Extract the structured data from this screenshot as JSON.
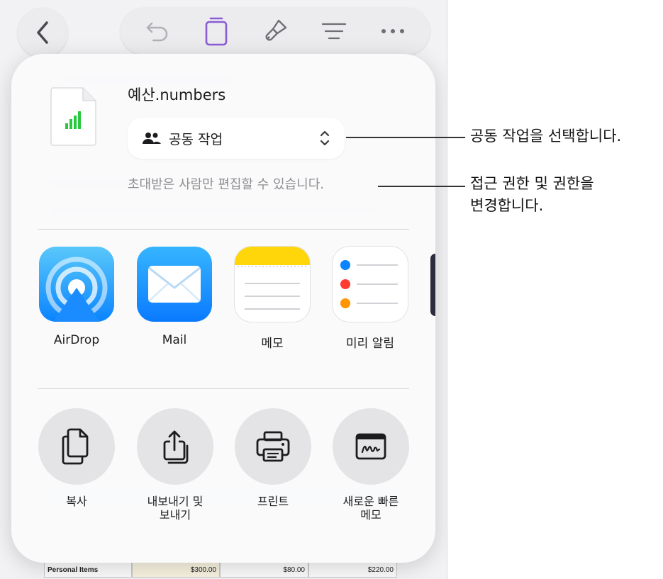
{
  "toolbar": {
    "back_icon": "chevron-left-icon",
    "icons": [
      "undo-icon",
      "document-icon",
      "paintbrush-icon",
      "format-icon",
      "more-icon"
    ],
    "accent_color": "#8a5cd6"
  },
  "sheet": {
    "file_name": "예산.numbers",
    "collab_label": "공동 작업",
    "access_text": "초대받은 사람만 편집할 수 있습니다.",
    "apps": [
      {
        "label": "AirDrop",
        "icon": "airdrop-icon"
      },
      {
        "label": "Mail",
        "icon": "mail-icon"
      },
      {
        "label": "메모",
        "icon": "notes-icon"
      },
      {
        "label": "미리 알림",
        "icon": "reminders-icon"
      }
    ],
    "actions": [
      {
        "label": "복사",
        "icon": "copy-icon"
      },
      {
        "label": "내보내기 및\n보내기",
        "icon": "export-icon"
      },
      {
        "label": "프린트",
        "icon": "print-icon"
      },
      {
        "label": "새로운 빠른\n메모",
        "icon": "quick-note-icon"
      }
    ]
  },
  "background_table": {
    "row_label": "Personal Items",
    "values": [
      "$300.00",
      "$80.00",
      "$220.00"
    ]
  },
  "callouts": {
    "collab": "공동 작업을 선택합니다.",
    "access": "접근 권한 및 권한을\n변경합니다."
  }
}
